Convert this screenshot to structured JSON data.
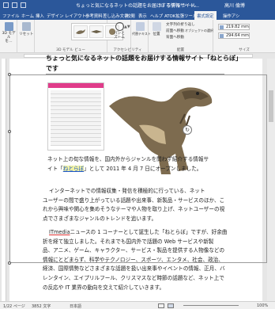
{
  "window": {
    "title": "ちょっと気になるネットの話題をお届けする情報サイト…",
    "context_tab": "3D モデル ツール",
    "user": "高川 倫博"
  },
  "tabs": [
    "ファイル",
    "ホーム",
    "挿入",
    "デザイン",
    "レイアウト",
    "参考資料",
    "差し込み文書",
    "校閲",
    "表示",
    "ヘルプ",
    "ATOK拡張ツール",
    "書式設定",
    "操作アシ"
  ],
  "ribbon": {
    "view3d_label": "3D モデル\nを…",
    "reset_label": "リセット",
    "gallery_label": "3D モデル ビュー",
    "pan_zoom_label": "パンと\nズーム",
    "accessibility_group": "アクセシビリティ",
    "alt_text_label": "代替テキスト",
    "position_label": "位置",
    "wrap_label": "文字列の折り返し",
    "forward_label": "前面へ移動",
    "backward_label": "背面へ移動",
    "selection_pane_label": "オブジェクトの選択",
    "arrange_group": "配置",
    "height_value": "219.82 mm",
    "width_value": "294.64 mm",
    "size_group": "サイズ"
  },
  "document": {
    "heading_line1": "ちょっと気になるネットの話題をお届けする情報サイト「ねとらぼ」",
    "heading_line2": "です",
    "para1_line1": "ネット上の旬な情報を、国内外からジャンルを問わず紹介する情報サ",
    "para1_line2_a": "イト「",
    "para1_line2_link": "ねとらぼ",
    "para1_line2_b": "」として 2011 年 4 月 7 日にオープンしました。",
    "para2_line1": "インターネットでの情報収集・発信を積極的に行っている、ネット",
    "para2_line2": "ユーザーの間で盛り上がっている話題や出来事、新製品・サービスのほか、こ",
    "para2_line3": "れから興味や関心を集めそうなテーマや人物を取り上げ、ネットユーザーの視",
    "para2_line4": "点でさまざまなジャンルのトレンドを追います。",
    "para3_line1_a": "ITmedia",
    "para3_line1_b": "ニュースの 1 コーナーとして誕生した「ねとらぼ」ですが、好余曲",
    "para3_line2": "折を経て独立しました。それまでも国内外で話題の Web サービスや新製",
    "para3_line3": "品、アニメ、ゲーム、キャラクター、サービス・製品を提供する人物像などの",
    "para3_line4": "情報にとどまらず、科学やテクノロジー、スポーツ、エンタメ、社会、政治、",
    "para3_line5": "経済、国際情勢などさまざまな話題を扱い出来事やイベントの情報、正月、バ",
    "para3_line6": "レンタイン、エイプリルフール、クリスマスなど時節の話題など、ネット上で",
    "para3_line7": "の反応や IT 業界の動向を交えて紹介していきます。"
  },
  "status": {
    "page": "1/22 ページ",
    "words": "3852 文字",
    "lang": "日本語",
    "zoom": "100%"
  },
  "colors": {
    "accent": "#2b579a",
    "link": "#1a55c9",
    "highlight": "#f2f3a5"
  }
}
